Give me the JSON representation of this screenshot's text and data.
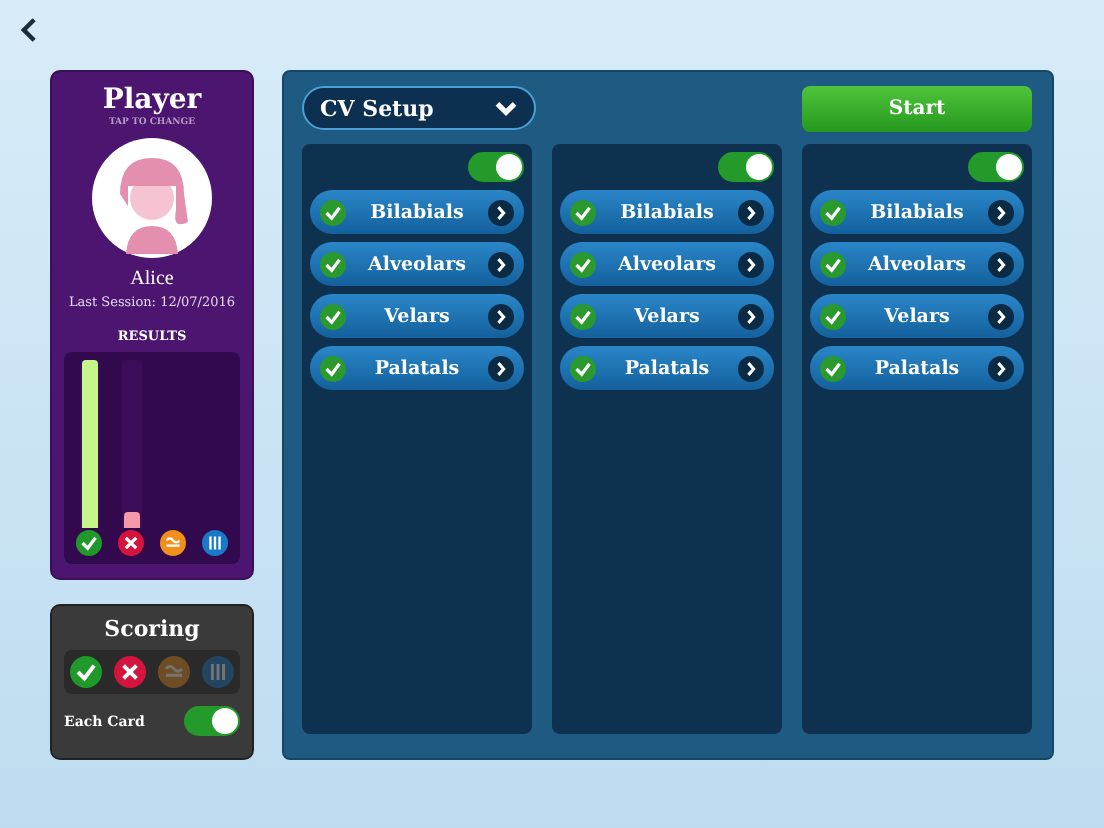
{
  "player": {
    "title": "Player",
    "subtitle": "TAP TO CHANGE",
    "name": "Alice",
    "last_session": "Last Session: 12/07/2016",
    "results_label": "RESULTS",
    "results": [
      {
        "kind": "correct",
        "level": 1
      },
      {
        "kind": "wrong",
        "level": 0.1
      },
      {
        "kind": "approx"
      },
      {
        "kind": "pause"
      }
    ]
  },
  "scoring": {
    "title": "Scoring",
    "marks": [
      {
        "kind": "correct",
        "on": true
      },
      {
        "kind": "wrong",
        "on": true
      },
      {
        "kind": "approx",
        "on": false
      },
      {
        "kind": "pause",
        "on": false
      }
    ],
    "each_card": {
      "label": "Each Card",
      "on": true
    }
  },
  "setup": {
    "dropdown": "CV Setup",
    "start": "Start",
    "columns": [
      {
        "on": true,
        "items": [
          {
            "label": "Bilabials",
            "checked": true
          },
          {
            "label": "Alveolars",
            "checked": true
          },
          {
            "label": "Velars",
            "checked": true
          },
          {
            "label": "Palatals",
            "checked": true
          }
        ]
      },
      {
        "on": true,
        "items": [
          {
            "label": "Bilabials",
            "checked": true
          },
          {
            "label": "Alveolars",
            "checked": true
          },
          {
            "label": "Velars",
            "checked": true
          },
          {
            "label": "Palatals",
            "checked": true
          }
        ]
      },
      {
        "on": true,
        "items": [
          {
            "label": "Bilabials",
            "checked": true
          },
          {
            "label": "Alveolars",
            "checked": true
          },
          {
            "label": "Velars",
            "checked": true
          },
          {
            "label": "Palatals",
            "checked": true
          }
        ]
      }
    ]
  }
}
